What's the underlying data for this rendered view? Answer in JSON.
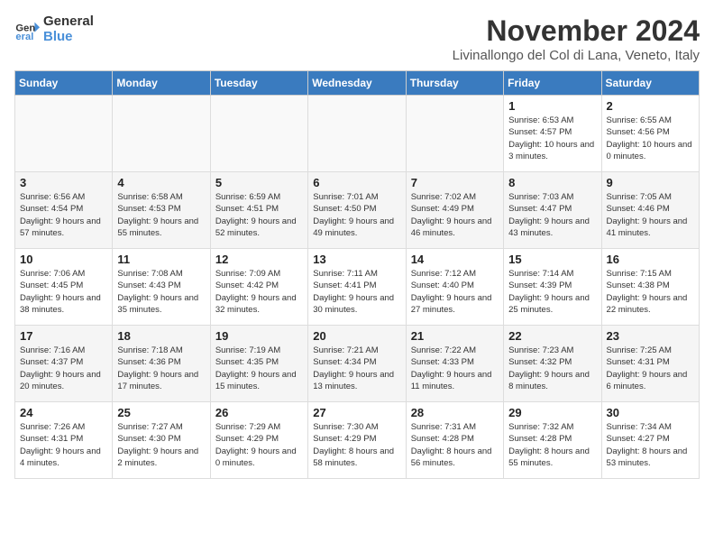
{
  "logo": {
    "line1": "General",
    "line2": "Blue"
  },
  "title": "November 2024",
  "location": "Livinallongo del Col di Lana, Veneto, Italy",
  "days_of_week": [
    "Sunday",
    "Monday",
    "Tuesday",
    "Wednesday",
    "Thursday",
    "Friday",
    "Saturday"
  ],
  "weeks": [
    [
      {
        "day": "",
        "info": ""
      },
      {
        "day": "",
        "info": ""
      },
      {
        "day": "",
        "info": ""
      },
      {
        "day": "",
        "info": ""
      },
      {
        "day": "",
        "info": ""
      },
      {
        "day": "1",
        "info": "Sunrise: 6:53 AM\nSunset: 4:57 PM\nDaylight: 10 hours and 3 minutes."
      },
      {
        "day": "2",
        "info": "Sunrise: 6:55 AM\nSunset: 4:56 PM\nDaylight: 10 hours and 0 minutes."
      }
    ],
    [
      {
        "day": "3",
        "info": "Sunrise: 6:56 AM\nSunset: 4:54 PM\nDaylight: 9 hours and 57 minutes."
      },
      {
        "day": "4",
        "info": "Sunrise: 6:58 AM\nSunset: 4:53 PM\nDaylight: 9 hours and 55 minutes."
      },
      {
        "day": "5",
        "info": "Sunrise: 6:59 AM\nSunset: 4:51 PM\nDaylight: 9 hours and 52 minutes."
      },
      {
        "day": "6",
        "info": "Sunrise: 7:01 AM\nSunset: 4:50 PM\nDaylight: 9 hours and 49 minutes."
      },
      {
        "day": "7",
        "info": "Sunrise: 7:02 AM\nSunset: 4:49 PM\nDaylight: 9 hours and 46 minutes."
      },
      {
        "day": "8",
        "info": "Sunrise: 7:03 AM\nSunset: 4:47 PM\nDaylight: 9 hours and 43 minutes."
      },
      {
        "day": "9",
        "info": "Sunrise: 7:05 AM\nSunset: 4:46 PM\nDaylight: 9 hours and 41 minutes."
      }
    ],
    [
      {
        "day": "10",
        "info": "Sunrise: 7:06 AM\nSunset: 4:45 PM\nDaylight: 9 hours and 38 minutes."
      },
      {
        "day": "11",
        "info": "Sunrise: 7:08 AM\nSunset: 4:43 PM\nDaylight: 9 hours and 35 minutes."
      },
      {
        "day": "12",
        "info": "Sunrise: 7:09 AM\nSunset: 4:42 PM\nDaylight: 9 hours and 32 minutes."
      },
      {
        "day": "13",
        "info": "Sunrise: 7:11 AM\nSunset: 4:41 PM\nDaylight: 9 hours and 30 minutes."
      },
      {
        "day": "14",
        "info": "Sunrise: 7:12 AM\nSunset: 4:40 PM\nDaylight: 9 hours and 27 minutes."
      },
      {
        "day": "15",
        "info": "Sunrise: 7:14 AM\nSunset: 4:39 PM\nDaylight: 9 hours and 25 minutes."
      },
      {
        "day": "16",
        "info": "Sunrise: 7:15 AM\nSunset: 4:38 PM\nDaylight: 9 hours and 22 minutes."
      }
    ],
    [
      {
        "day": "17",
        "info": "Sunrise: 7:16 AM\nSunset: 4:37 PM\nDaylight: 9 hours and 20 minutes."
      },
      {
        "day": "18",
        "info": "Sunrise: 7:18 AM\nSunset: 4:36 PM\nDaylight: 9 hours and 17 minutes."
      },
      {
        "day": "19",
        "info": "Sunrise: 7:19 AM\nSunset: 4:35 PM\nDaylight: 9 hours and 15 minutes."
      },
      {
        "day": "20",
        "info": "Sunrise: 7:21 AM\nSunset: 4:34 PM\nDaylight: 9 hours and 13 minutes."
      },
      {
        "day": "21",
        "info": "Sunrise: 7:22 AM\nSunset: 4:33 PM\nDaylight: 9 hours and 11 minutes."
      },
      {
        "day": "22",
        "info": "Sunrise: 7:23 AM\nSunset: 4:32 PM\nDaylight: 9 hours and 8 minutes."
      },
      {
        "day": "23",
        "info": "Sunrise: 7:25 AM\nSunset: 4:31 PM\nDaylight: 9 hours and 6 minutes."
      }
    ],
    [
      {
        "day": "24",
        "info": "Sunrise: 7:26 AM\nSunset: 4:31 PM\nDaylight: 9 hours and 4 minutes."
      },
      {
        "day": "25",
        "info": "Sunrise: 7:27 AM\nSunset: 4:30 PM\nDaylight: 9 hours and 2 minutes."
      },
      {
        "day": "26",
        "info": "Sunrise: 7:29 AM\nSunset: 4:29 PM\nDaylight: 9 hours and 0 minutes."
      },
      {
        "day": "27",
        "info": "Sunrise: 7:30 AM\nSunset: 4:29 PM\nDaylight: 8 hours and 58 minutes."
      },
      {
        "day": "28",
        "info": "Sunrise: 7:31 AM\nSunset: 4:28 PM\nDaylight: 8 hours and 56 minutes."
      },
      {
        "day": "29",
        "info": "Sunrise: 7:32 AM\nSunset: 4:28 PM\nDaylight: 8 hours and 55 minutes."
      },
      {
        "day": "30",
        "info": "Sunrise: 7:34 AM\nSunset: 4:27 PM\nDaylight: 8 hours and 53 minutes."
      }
    ]
  ]
}
